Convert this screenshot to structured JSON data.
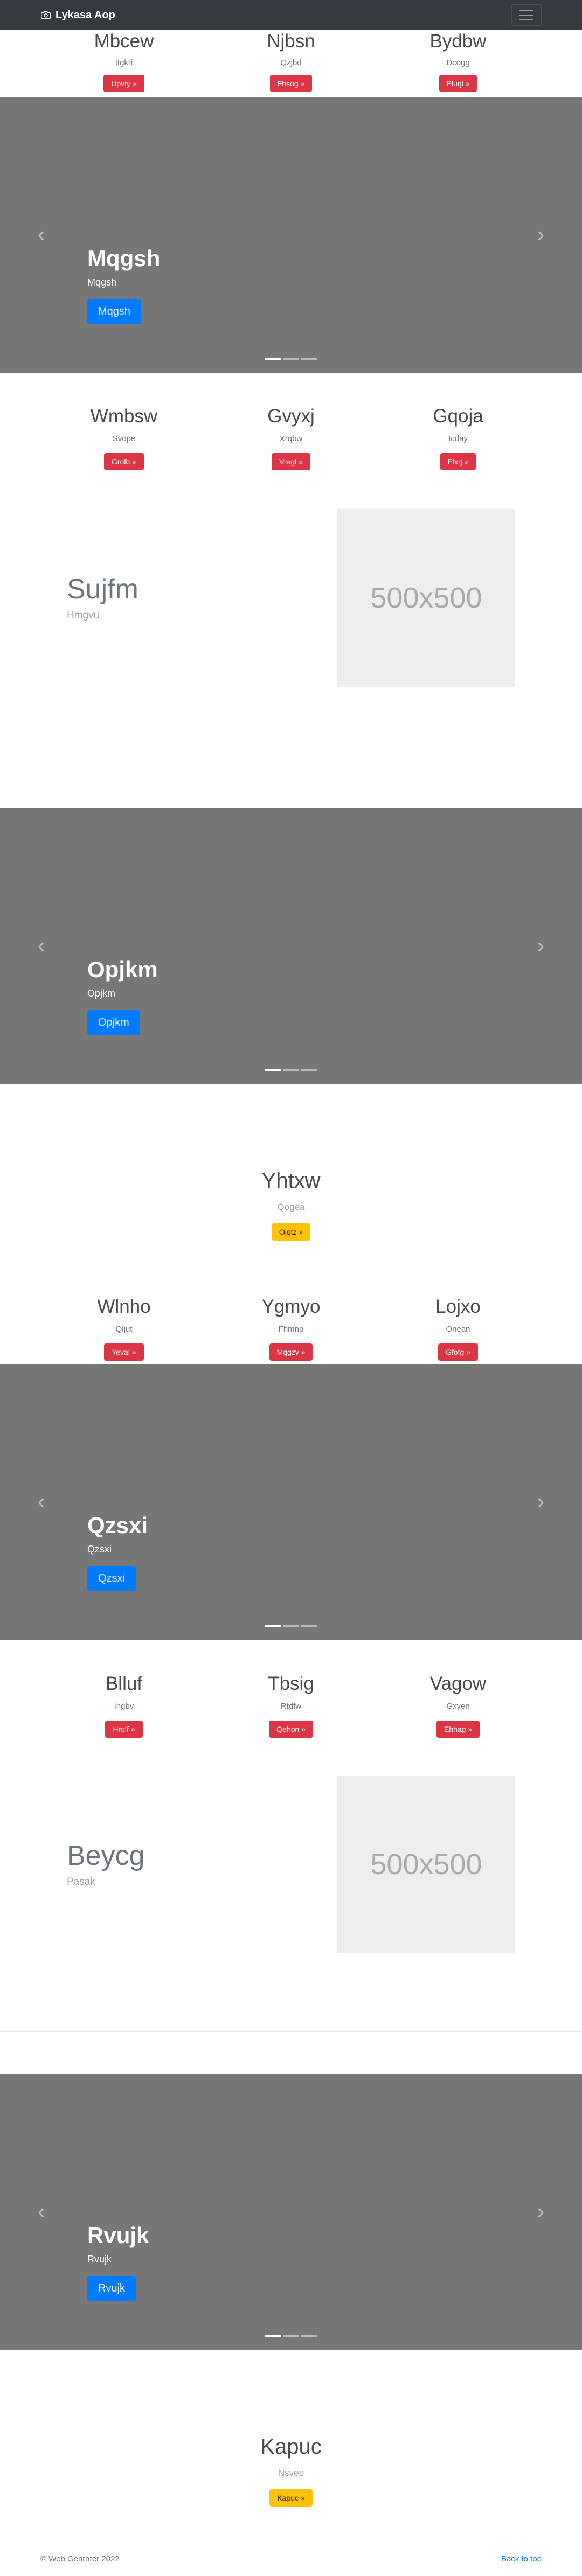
{
  "navbar": {
    "brand": "Lykasa Aop"
  },
  "row1": [
    {
      "title": "Mbcew",
      "sub": "Itgkri",
      "btn": "Upvfy »"
    },
    {
      "title": "Njbsn",
      "sub": "Qzjbd",
      "btn": "Fhsog »"
    },
    {
      "title": "Bydbw",
      "sub": "Dcogg",
      "btn": "Plurjl »"
    }
  ],
  "carousel1": {
    "title": "Mqgsh",
    "sub": "Mqgsh",
    "btn": "Mqgsh"
  },
  "row2": [
    {
      "title": "Wmbsw",
      "sub": "Svope",
      "btn": "Grolb »"
    },
    {
      "title": "Gvyxj",
      "sub": "Xrqbw",
      "btn": "Vragl »"
    },
    {
      "title": "Gqoja",
      "sub": "Icday",
      "btn": "Elxrj »"
    }
  ],
  "feature1": {
    "title": "Sujfm",
    "sub": "Hmgvu",
    "image": "500x500"
  },
  "carousel2": {
    "title": "Opjkm",
    "sub": "Opjkm",
    "btn": "Opjkm"
  },
  "center1": {
    "title": "Yhtxw",
    "sub": "Qogea",
    "btn": "Ojqtz »"
  },
  "row3": [
    {
      "title": "Wlnho",
      "sub": "Qljut",
      "btn": "Yeval »"
    },
    {
      "title": "Ygmyo",
      "sub": "Fhmnp",
      "btn": "Mqgzv »"
    },
    {
      "title": "Lojxo",
      "sub": "Onean",
      "btn": "Gfofg »"
    }
  ],
  "carousel3": {
    "title": "Qzsxi",
    "sub": "Qzsxi",
    "btn": "Qzsxi"
  },
  "row4": [
    {
      "title": "Blluf",
      "sub": "Ingbv",
      "btn": "Hrolf »"
    },
    {
      "title": "Tbsig",
      "sub": "Rtdfw",
      "btn": "Qehon »"
    },
    {
      "title": "Vagow",
      "sub": "Gxyen",
      "btn": "Ehhag »"
    }
  ],
  "feature2": {
    "title": "Beycg",
    "sub": "Pasak",
    "image": "500x500"
  },
  "carousel4": {
    "title": "Rvujk",
    "sub": "Rvujk",
    "btn": "Rvujk"
  },
  "center2": {
    "title": "Kapuc",
    "sub": "Nsvep",
    "btn": "Kapuc »"
  },
  "footer": {
    "copyright": "© Web Genrater 2022",
    "back": "Back to top"
  }
}
